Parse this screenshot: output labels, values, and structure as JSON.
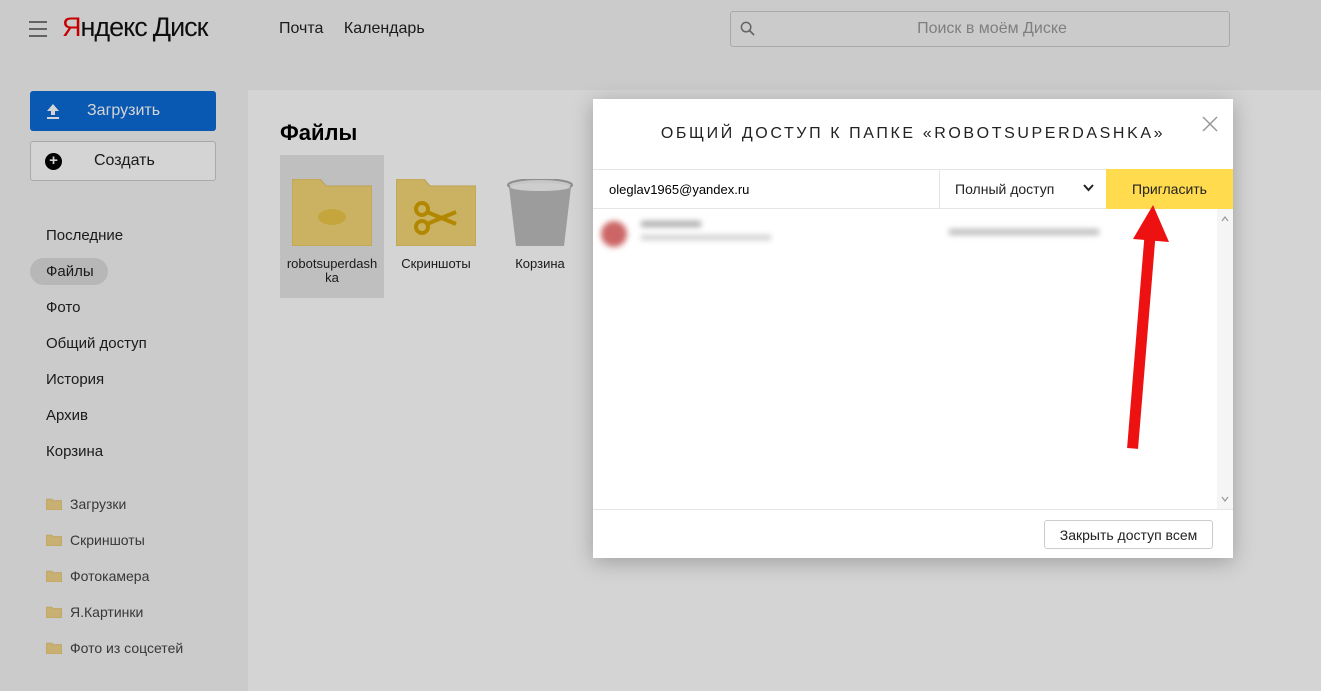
{
  "header": {
    "logo_yandex_first": "Я",
    "logo_yandex_rest": "ндекс",
    "logo_product": "Диск",
    "nav": [
      "Почта",
      "Календарь"
    ],
    "search_placeholder": "Поиск в моём Диске"
  },
  "sidebar": {
    "upload_label": "Загрузить",
    "create_label": "Создать",
    "items": [
      {
        "label": "Последние"
      },
      {
        "label": "Файлы",
        "active": true
      },
      {
        "label": "Фото"
      },
      {
        "label": "Общий доступ"
      },
      {
        "label": "История"
      },
      {
        "label": "Архив"
      },
      {
        "label": "Корзина"
      }
    ],
    "folders": [
      {
        "label": "Загрузки"
      },
      {
        "label": "Скриншоты"
      },
      {
        "label": "Фотокамера"
      },
      {
        "label": "Я.Картинки"
      },
      {
        "label": "Фото из соцсетей"
      }
    ]
  },
  "main": {
    "title": "Файлы",
    "tiles": [
      {
        "name": "robotsuperdashka",
        "icon": "folder-icon",
        "selected": true
      },
      {
        "name": "Скриншоты",
        "icon": "scissors-folder-icon"
      },
      {
        "name": "Корзина",
        "icon": "trash-icon"
      }
    ]
  },
  "modal": {
    "title": "ОБЩИЙ ДОСТУП К ПАПКЕ «ROBOTSUPERDASHKA»",
    "email_value": "oleglav1965@yandex.ru",
    "access_level": "Полный доступ",
    "invite_label": "Пригласить",
    "revoke_all_label": "Закрыть доступ всем"
  },
  "colors": {
    "accent_blue": "#0b6bd6",
    "invite_yellow": "#ffdb4d",
    "folder_yellow": "#f5d777",
    "annotation_arrow": "#ee1111"
  }
}
